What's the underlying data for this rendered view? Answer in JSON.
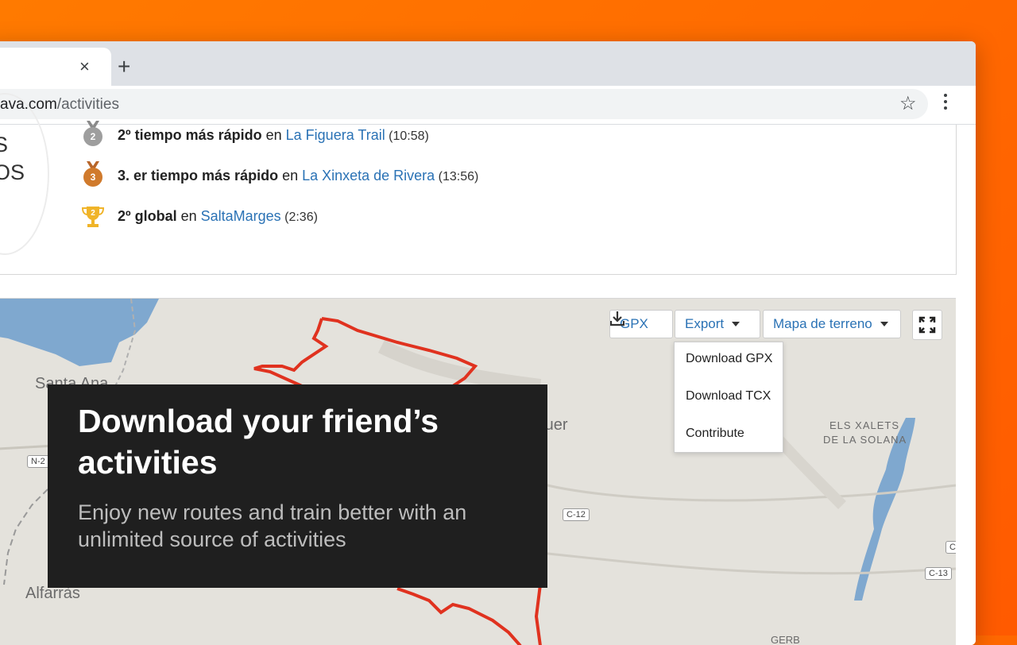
{
  "browser": {
    "tab_close": "×",
    "new_tab": "+",
    "url_host": "ava.com",
    "url_path": "/activities",
    "star": "☆"
  },
  "achievements": {
    "side_text_1": "S",
    "side_text_2": "OS",
    "items": [
      {
        "medal": "2",
        "medal_color": "#9e9e9e",
        "bold": "2º tiempo más rápido",
        "connector": " en ",
        "link": "La Figuera Trail",
        "time": " (10:58)"
      },
      {
        "medal": "3",
        "medal_color": "#d07a2c",
        "bold": "3. er tiempo más rápido",
        "connector": " en ",
        "link": "La Xinxeta de Rivera",
        "time": " (13:56)"
      },
      {
        "medal": "2",
        "medal_color": "#f0b429",
        "bold": "2º global",
        "connector": " en ",
        "link": "SaltaMarges",
        "time": " (2:36)"
      }
    ]
  },
  "map": {
    "gpx_button": "GPX",
    "export_button": "Export",
    "terrain_button": "Mapa de terreno",
    "dropdown": [
      "Download GPX",
      "Download TCX",
      "Contribute"
    ],
    "labels": {
      "santa_ana": "Santa Ana",
      "balaguer": "os de Balaguer",
      "alfarras": "Alfarràs",
      "xalets_1": "ELS XALETS",
      "xalets_2": "DE LA SOLANA",
      "gerb": "GERB"
    },
    "roads": {
      "n2": "N-2",
      "c12": "C-12",
      "c13": "C-13",
      "c": "C"
    }
  },
  "promo": {
    "title": "Download your friend’s activities",
    "subtitle": "Enjoy new routes and train better with an unlimited source of activities"
  }
}
